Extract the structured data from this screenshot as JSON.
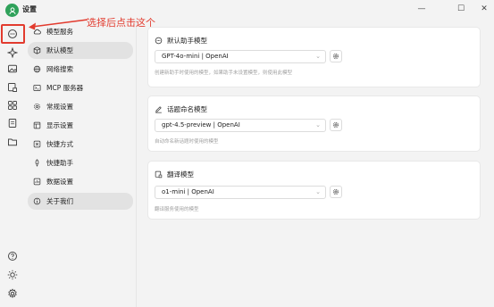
{
  "window": {
    "title": "设置",
    "controls": {
      "minimize": "—",
      "maximize": "☐",
      "close": "✕"
    }
  },
  "annotation": {
    "text": "选择后点击这个",
    "color": "#e23b2e"
  },
  "rail": {
    "icons": [
      "assistant-icon",
      "sparkle-icon",
      "image-icon",
      "translate-icon",
      "apps-icon",
      "files-icon",
      "folder-icon",
      "help-icon",
      "theme-sun-icon",
      "settings-gear-icon"
    ]
  },
  "menu": {
    "items": [
      {
        "label": "模型服务",
        "icon": "cloud-icon"
      },
      {
        "label": "默认模型",
        "icon": "package-icon",
        "active": true
      },
      {
        "label": "网络搜索",
        "icon": "globe-icon"
      },
      {
        "label": "MCP 服务器",
        "icon": "terminal-icon"
      },
      {
        "label": "常规设置",
        "icon": "gear-icon"
      },
      {
        "label": "显示设置",
        "icon": "monitor-icon"
      },
      {
        "label": "快捷方式",
        "icon": "command-icon"
      },
      {
        "label": "快捷助手",
        "icon": "rocket-icon"
      },
      {
        "label": "数据设置",
        "icon": "database-icon"
      },
      {
        "label": "关于我们",
        "icon": "info-icon"
      }
    ]
  },
  "cards": {
    "default_assistant": {
      "title": "默认助手模型",
      "selected": "GPT-4o-mini | OpenAI",
      "hint": "创建新助手时使用的模型，如果助手未设置模型，则使用此模型"
    },
    "topic_naming": {
      "title": "话题命名模型",
      "selected": "gpt-4.5-preview | OpenAI",
      "hint": "自动命名新话题时使用的模型"
    },
    "translate": {
      "title": "翻译模型",
      "selected": "o1-mini | OpenAI",
      "hint": "翻译服务使用的模型"
    }
  },
  "colors": {
    "accent_green": "#2fa15a",
    "highlight_red": "#e23b2e"
  }
}
